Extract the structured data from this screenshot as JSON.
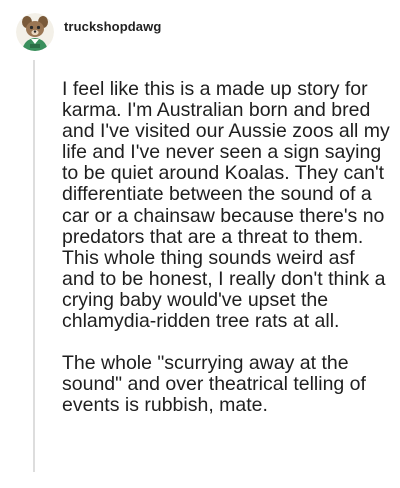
{
  "post": {
    "username": "truckshopdawg",
    "avatar_icon": "dog-avatar-icon",
    "paragraphs": [
      "I feel like this is a made up story for karma. I'm Australian born and bred and I've visited our Aussie zoos all my life and I've never seen a sign saying to be quiet around Koalas. They can't differentiate between the sound of a car or a chainsaw because there's no predators that are a threat to them. This whole thing sounds weird asf and to be honest, I really don't think a crying baby would've upset the chlamydia-ridden tree rats at all.",
      "The whole \"scurrying away at the sound\" and over theatrical telling of events is rubbish, mate."
    ]
  }
}
